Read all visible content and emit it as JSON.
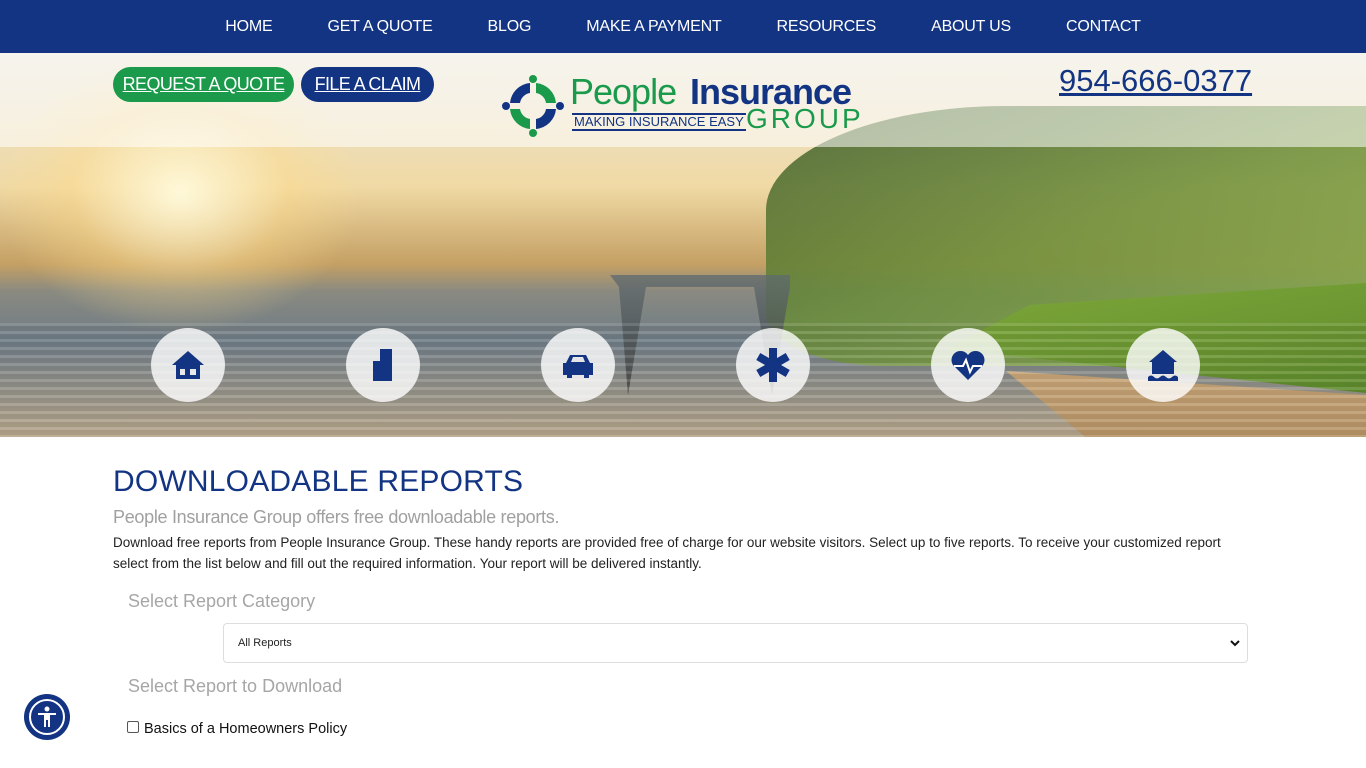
{
  "nav": {
    "items": [
      "HOME",
      "GET A QUOTE",
      "BLOG",
      "MAKE A PAYMENT",
      "RESOURCES",
      "ABOUT US",
      "CONTACT"
    ]
  },
  "header": {
    "request_quote": "REQUEST A QUOTE",
    "file_claim": "FILE A CLAIM",
    "phone": "954-666-0377",
    "logo": {
      "word1": "People",
      "word2": "Insurance",
      "tagline": "MAKING INSURANCE EASY",
      "group": "GROUP"
    }
  },
  "hero": {
    "icons": [
      "home-icon",
      "building-icon",
      "car-icon",
      "star-of-life-icon",
      "heart-pulse-icon",
      "flood-house-icon"
    ]
  },
  "main": {
    "title": "DOWNLOADABLE REPORTS",
    "subtitle": "People Insurance Group offers free downloadable reports.",
    "description": "Download free reports from People Insurance Group. These handy reports are provided free of charge for our website visitors. Select up to five reports. To receive your customized report select from the list below and fill out the required information. Your report will be delivered instantly.",
    "category_label": "Select Report Category",
    "category_value": "All Reports",
    "download_label": "Select Report to Download",
    "reports": [
      {
        "label": "Basics of a Homeowners Policy",
        "checked": false
      }
    ]
  },
  "colors": {
    "navy": "#133483",
    "green": "#1a9a4a"
  }
}
